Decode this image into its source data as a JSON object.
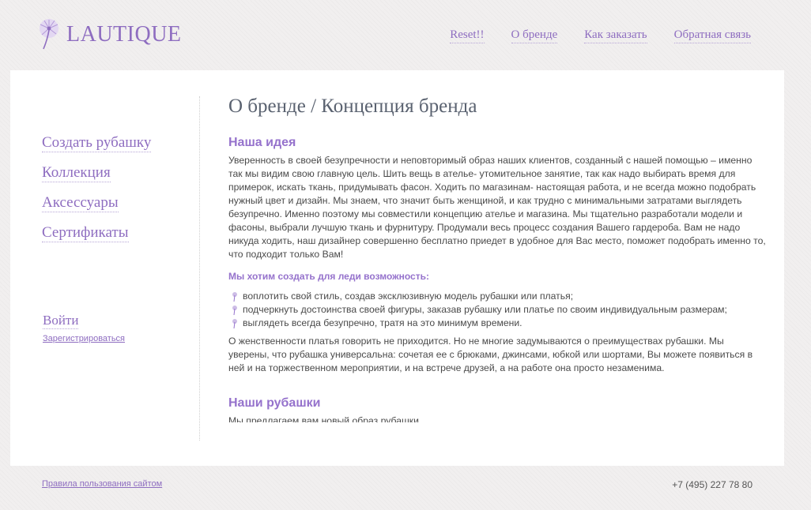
{
  "header": {
    "logo_text": "LAUTIQUE",
    "nav": [
      "Reset!!",
      "О бренде",
      "Как заказать",
      "Обратная связь"
    ]
  },
  "sidebar": {
    "items": [
      {
        "label": "Создать рубашку"
      },
      {
        "label": "Коллекция"
      },
      {
        "label": "Аксессуары"
      },
      {
        "label": "Сертификаты"
      }
    ],
    "login_label": "Войти",
    "register_label": "Зарегистрироваться"
  },
  "main": {
    "title": "О бренде / Концепция бренда",
    "section1_heading": "Наша идея",
    "paragraph1": "Уверенность в своей безупречности и неповторимый образ наших клиентов, созданный с нашей помощью – именно так мы видим свою главную цель. Шить вещь в ателье- утомительное занятие, так как надо выбирать время для примерок, искать ткань, придумывать фасон. Ходить по магазинам- настоящая работа, и не всегда можно подобрать нужный цвет и дизайн. Мы знаем, что значит быть женщиной, и как трудно с минимальными затратами выглядеть безупречно. Именно поэтому мы совместили концепцию ателье и магазина. Мы тщательно разработали модели и фасоны, выбрали лучшую ткань и фурнитуру. Продумали весь процесс создания Вашего гардероба. Вам не надо никуда ходить, наш дизайнер совершенно бесплатно приедет в удобное для Вас место, поможет подобрать именно то, что подходит только Вам!",
    "subheading": "Мы хотим создать для леди возможность:",
    "bullets": [
      "воплотить свой стиль, создав эксклюзивную модель рубашки или платья;",
      "подчеркнуть достоинства своей фигуры, заказав рубашку или платье по своим индивидуальным размерам;",
      "выглядеть всегда безупречно, тратя на это минимум времени."
    ],
    "paragraph2": "О женственности платья говорить не приходится. Но не многие задумываются о преимуществах рубашки. Мы уверены, что  рубашка универсальна: сочетая ее с брюками, джинсами, юбкой или шортами, Вы можете появиться в ней и на торжественном мероприятии, и на встрече друзей, а на работе она просто незаменима.",
    "section2_heading": "Наши рубашки",
    "section2_text": "Мы предлагаем вам новый образ рубашки"
  },
  "footer": {
    "terms_label": "Правила пользования сайтом",
    "phone": "+7 (495) 227 78 80"
  },
  "colors": {
    "accent": "#8e6dc0",
    "heading_purple": "#9572cc",
    "title_gray": "#5a6270",
    "background": "#f1efef",
    "panel": "#ffffff"
  },
  "icons": {
    "logo": "dandelion-icon",
    "bullet": "dandelion-bullet-icon"
  }
}
